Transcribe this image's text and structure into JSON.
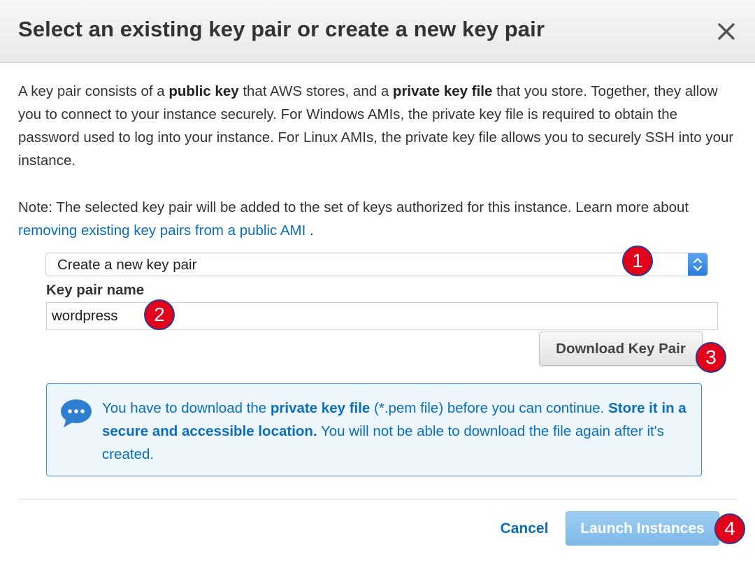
{
  "dialog": {
    "title": "Select an existing key pair or create a new key pair",
    "close_label": "×"
  },
  "description": {
    "p1_part1": "A key pair consists of a ",
    "p1_bold1": "public key",
    "p1_part2": " that AWS stores, and a ",
    "p1_bold2": "private key file",
    "p1_part3": " that you store. Together, they allow you to connect to your instance securely. For Windows AMIs, the private key file is required to obtain the password used to log into your instance. For Linux AMIs, the private key file allows you to securely SSH into your instance.",
    "p2_part1": "Note: The selected key pair will be added to the set of keys authorized for this instance. Learn more about ",
    "p2_link": "removing existing key pairs from a public AMI",
    "p2_part2": " ."
  },
  "key_pair_select": {
    "selected": "Create a new key pair"
  },
  "key_pair_name": {
    "label": "Key pair name",
    "value": "wordpress"
  },
  "download_button": {
    "label": "Download Key Pair"
  },
  "info": {
    "icon": "chat-bubble-icon",
    "part1": "You have to download the ",
    "bold1": "private key file",
    "part2": " (*.pem file) before you can continue. ",
    "bold2": "Store it in a secure and accessible location.",
    "part3": " You will not be able to download the file again after it's created."
  },
  "footer": {
    "cancel_label": "Cancel",
    "launch_label": "Launch Instances"
  },
  "annotations": {
    "m1": "1",
    "m2": "2",
    "m3": "3",
    "m4": "4"
  },
  "colors": {
    "link": "#0a6ebd",
    "marker": "#e3001b",
    "launch_button": "#86bdea",
    "info_border": "#3d8fd6"
  }
}
